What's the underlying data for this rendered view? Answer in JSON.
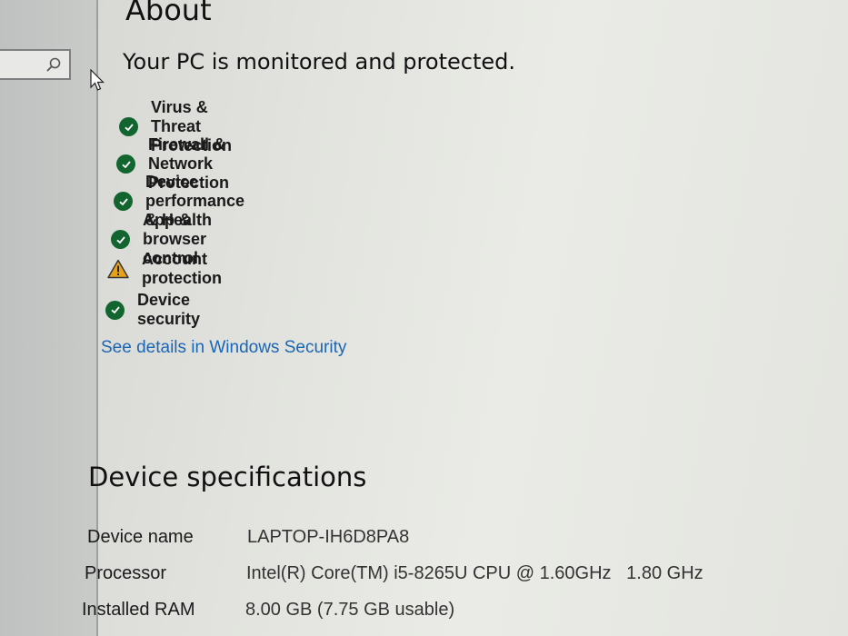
{
  "page": {
    "title": "About"
  },
  "security": {
    "heading": "Your PC is monitored and protected.",
    "items": [
      {
        "label": "Virus & Threat Protection",
        "status": "ok",
        "icon": "check-circle-icon"
      },
      {
        "label": "Firewall & Network Protection",
        "status": "ok",
        "icon": "check-circle-icon"
      },
      {
        "label": "Device performance & Health",
        "status": "ok",
        "icon": "check-circle-icon"
      },
      {
        "label": "App & browser control",
        "status": "ok",
        "icon": "check-circle-icon"
      },
      {
        "label": "Account protection",
        "status": "warning",
        "icon": "warning-triangle-icon"
      },
      {
        "label": "Device security",
        "status": "ok",
        "icon": "check-circle-icon"
      }
    ],
    "details_link": "See details in Windows Security"
  },
  "specs": {
    "heading": "Device specifications",
    "rows": [
      {
        "label": "Device name",
        "value": "LAPTOP-IH6D8PA8"
      },
      {
        "label": "Processor",
        "value": "Intel(R) Core(TM) i5-8265U CPU @ 1.60GHz   1.80 GHz"
      },
      {
        "label": "Installed RAM",
        "value": "8.00 GB (7.75 GB usable)"
      }
    ]
  },
  "colors": {
    "ok": "#13652f",
    "warning": "#e8a21a",
    "link": "#1a66b5"
  }
}
